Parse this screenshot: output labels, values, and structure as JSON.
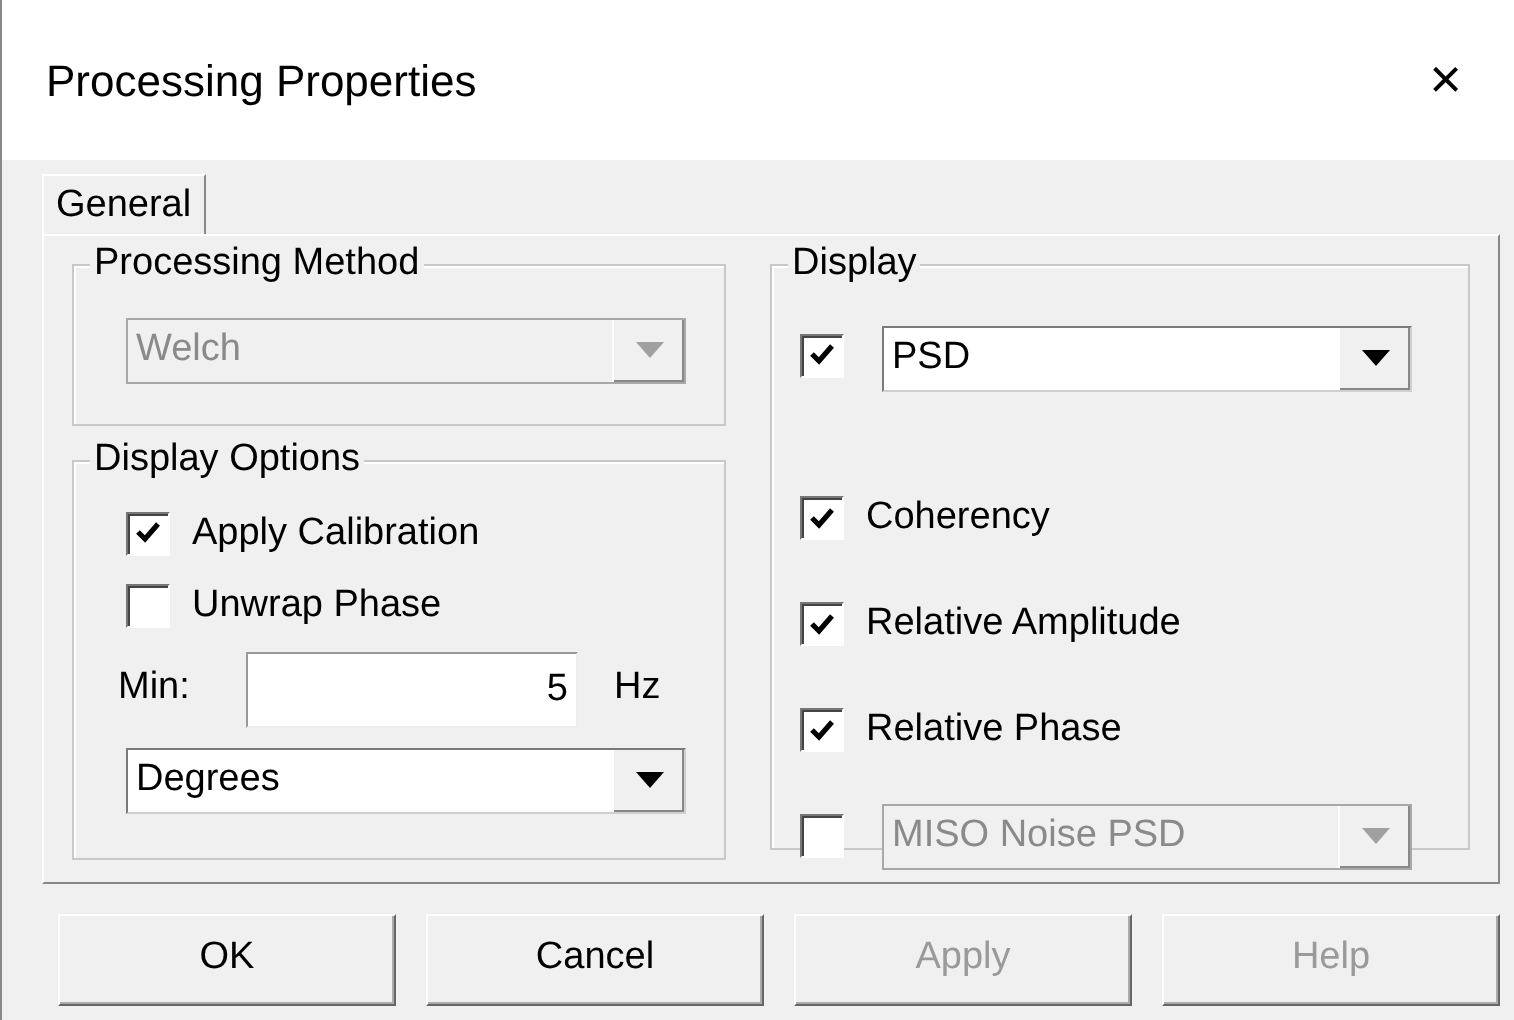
{
  "window": {
    "title": "Processing Properties",
    "close": "×"
  },
  "tabs": [
    {
      "label": "General",
      "selected": true
    }
  ],
  "processing_method": {
    "title": "Processing Method",
    "dropdown": {
      "value": "Welch",
      "disabled": true
    }
  },
  "display_options": {
    "title": "Display Options",
    "checkboxes": [
      {
        "label": "Apply Calibration",
        "checked": true
      },
      {
        "label": "Unwrap Phase",
        "checked": false
      }
    ],
    "min": {
      "label": "Min:",
      "value": "5",
      "unit": "Hz"
    },
    "dropdown": {
      "value": "Degrees",
      "disabled": false
    }
  },
  "display": {
    "title": "Display",
    "items": [
      {
        "kind": "dropdown",
        "checked": true,
        "value": "PSD",
        "disabled": false
      },
      {
        "kind": "checkbox",
        "label": "Coherency",
        "checked": true
      },
      {
        "kind": "checkbox",
        "label": "Relative Amplitude",
        "checked": true
      },
      {
        "kind": "checkbox",
        "label": "Relative Phase",
        "checked": true
      },
      {
        "kind": "dropdown",
        "checked": false,
        "value": "MISO Noise PSD",
        "disabled": true
      }
    ]
  },
  "buttons": [
    {
      "label": "OK",
      "disabled": false
    },
    {
      "label": "Cancel",
      "disabled": false
    },
    {
      "label": "Apply",
      "disabled": true
    },
    {
      "label": "Help",
      "disabled": true
    }
  ]
}
